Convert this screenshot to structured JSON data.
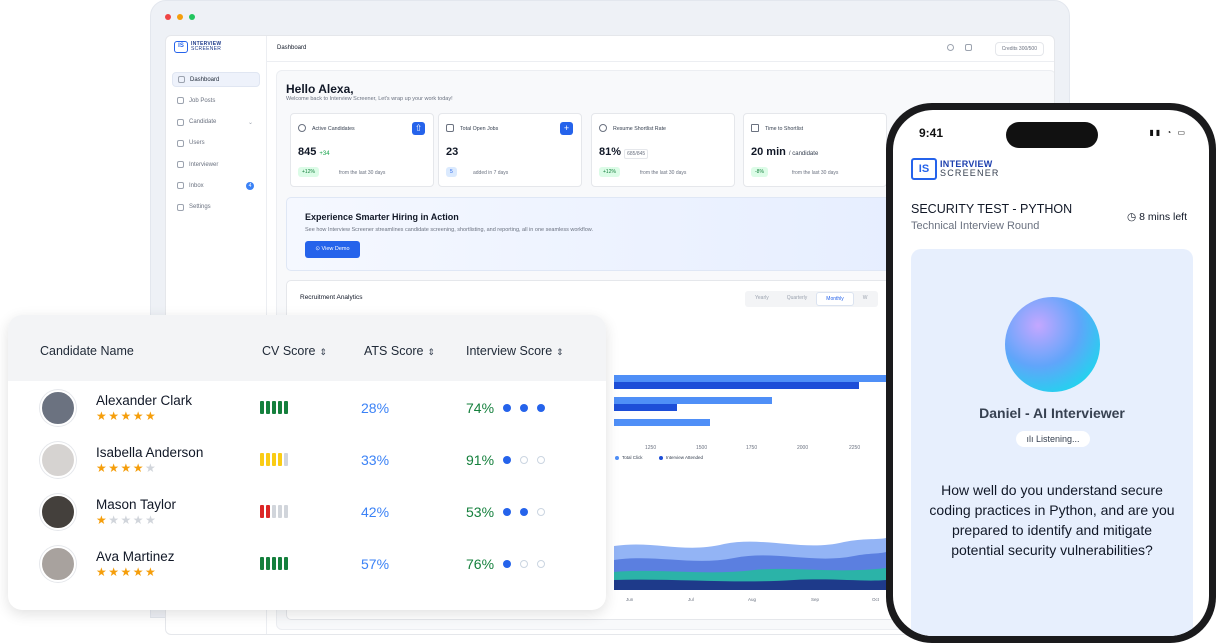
{
  "dashboard": {
    "logo_line1": "INTERVIEW",
    "logo_line2": "SCREENER",
    "logo_badge": "IS",
    "topbar_title": "Dashboard",
    "credits": "Credits 300/500",
    "nav": [
      {
        "label": "Dashboard"
      },
      {
        "label": "Job Posts"
      },
      {
        "label": "Candidate"
      },
      {
        "label": "Users"
      },
      {
        "label": "Interviewer"
      },
      {
        "label": "Inbox",
        "badge": "4"
      },
      {
        "label": "Settings"
      }
    ],
    "greeting": "Hello Alexa,",
    "welcome": "Welcome back to Interview Screener, Let's wrap up your work today!",
    "stats": [
      {
        "label": "Active Candidates",
        "value": "845",
        "delta": "+34",
        "chip": "+12%",
        "note": "from the last 30 days"
      },
      {
        "label": "Total Open Jobs",
        "value": "23",
        "chip": "5",
        "note": "added in 7 days"
      },
      {
        "label": "Resume Shortlist Rate",
        "value": "81%",
        "sub": "685/845",
        "chip": "+12%",
        "note": "from the last 30 days"
      },
      {
        "label": "Time to Shortlist",
        "value": "20 min",
        "unit": "/ candidate",
        "chip": "-8%",
        "note": "from the last 30 days"
      }
    ],
    "banner": {
      "title": "Experience Smarter Hiring in Action",
      "text": "See how Interview Screener streamlines candidate screening, shortlisting, and reporting, all in one seamless workflow.",
      "button": "View Demo"
    },
    "analytics": {
      "title": "Recruitment Analytics",
      "periods": [
        "Yearly",
        "Quarterly",
        "Monthly",
        "W"
      ],
      "x_ticks": [
        "1250",
        "1500",
        "1750",
        "2000",
        "2250"
      ],
      "legend": [
        "Total Click",
        "Interview Attended"
      ],
      "months": [
        "Jun",
        "Jul",
        "Aug",
        "Sep",
        "Oct"
      ]
    }
  },
  "candidates": {
    "headers": {
      "name": "Candidate Name",
      "cv": "CV Score",
      "ats": "ATS Score",
      "interview": "Interview Score"
    },
    "rows": [
      {
        "name": "Alexander Clark",
        "rating": 5,
        "cv_level": 5,
        "ats": "28%",
        "interview": "74%",
        "interview_dots": 3
      },
      {
        "name": "Isabella Anderson",
        "rating": 4,
        "cv_level": 4,
        "ats": "33%",
        "interview": "91%",
        "interview_dots": 1
      },
      {
        "name": "Mason Taylor",
        "rating": 1,
        "cv_level": 2,
        "ats": "42%",
        "interview": "53%",
        "interview_dots": 2
      },
      {
        "name": "Ava Martinez",
        "rating": 5,
        "cv_level": 5,
        "ats": "57%",
        "interview": "76%",
        "interview_dots": 1
      }
    ]
  },
  "phone": {
    "time": "9:41",
    "logo_line1": "INTERVIEW",
    "logo_line2": "SCREENER",
    "logo_badge": "IS",
    "title": "SECURITY TEST - PYTHON",
    "subtitle": "Technical Interview Round",
    "timer": "8 mins left",
    "interviewer": "Daniel - AI Interviewer",
    "status": "Listening...",
    "question": "How well do you understand secure coding practices in Python, and are you prepared to identify and mitigate potential security vulnerabilities?"
  },
  "colors": {
    "accent": "#2563eb",
    "good": "#15803d",
    "warn": "#facc15",
    "bad": "#dc2626",
    "ats": "#3b82f6"
  }
}
